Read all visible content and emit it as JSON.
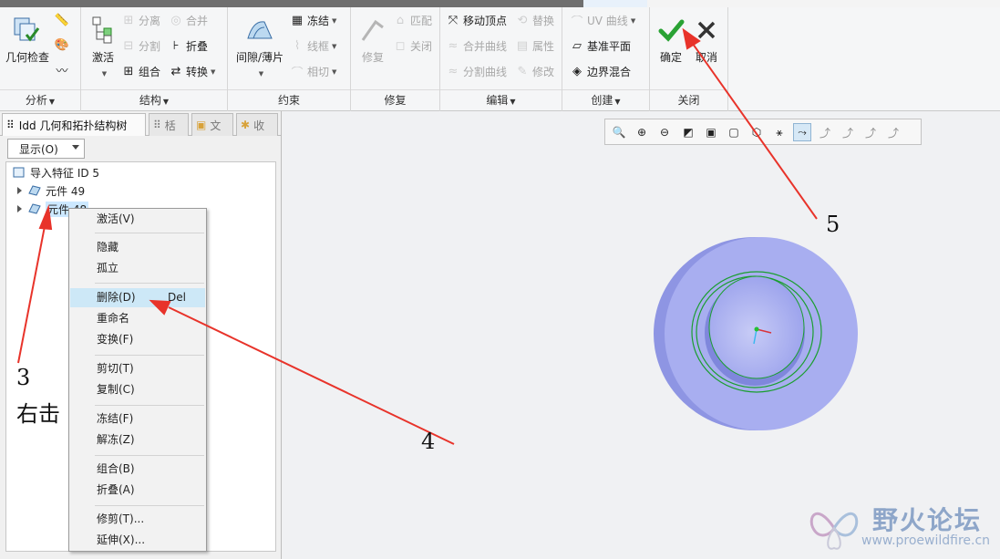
{
  "ribbon": {
    "groups": [
      {
        "key": "analysis",
        "label": "分析"
      },
      {
        "key": "structure",
        "label": "结构"
      },
      {
        "key": "constraint",
        "label": "约束"
      },
      {
        "key": "repair",
        "label": "修复"
      },
      {
        "key": "edit",
        "label": "编辑"
      },
      {
        "key": "create",
        "label": "创建"
      },
      {
        "key": "close",
        "label": "关闭"
      }
    ],
    "analysis": {
      "geom_check": "几何检查"
    },
    "structure": {
      "activate": "激活",
      "separate": "分离",
      "split": "分割",
      "group": "组合",
      "merge": "合并",
      "fold": "折叠",
      "convert": "转换"
    },
    "constraint": {
      "gap_thin": "间隙/薄片",
      "freeze": "冻结",
      "wireframe": "线框",
      "tangent": "相切"
    },
    "repair": {
      "repair": "修复",
      "match": "匹配",
      "close": "关闭"
    },
    "edit": {
      "move_vertex": "移动顶点",
      "merge_curve": "合并曲线",
      "split_curve": "分割曲线",
      "replace": "替换",
      "properties": "属性",
      "modify": "修改"
    },
    "create": {
      "uv_curve": "UV 曲线",
      "datum_plane": "基准平面",
      "boundary_blend": "边界混合"
    },
    "close": {
      "ok": "确定",
      "cancel": "取消"
    }
  },
  "left_panel": {
    "tabs": [
      {
        "label": "Idd 几何和拓扑结构树"
      },
      {
        "label": "栝"
      },
      {
        "label": "文"
      },
      {
        "label": "收"
      }
    ],
    "show_button": "显示(O)",
    "tree": [
      {
        "label": "导入特征 ID 5",
        "level": 0
      },
      {
        "label": "元件 49",
        "level": 1
      },
      {
        "label": "元件 48",
        "level": 1,
        "selected": true
      }
    ]
  },
  "context_menu": {
    "items": [
      {
        "label": "激活(V)"
      },
      {
        "label": "隐藏"
      },
      {
        "label": "孤立"
      },
      {
        "label": "删除(D)",
        "shortcut": "Del",
        "highlighted": true
      },
      {
        "label": "重命名"
      },
      {
        "label": "变换(F)"
      },
      {
        "label": "剪切(T)"
      },
      {
        "label": "复制(C)"
      },
      {
        "label": "冻结(F)"
      },
      {
        "label": "解冻(Z)"
      },
      {
        "label": "组合(B)"
      },
      {
        "label": "折叠(A)"
      },
      {
        "label": "修剪(T)..."
      },
      {
        "label": "延伸(X)..."
      }
    ]
  },
  "annotations": {
    "three": "3",
    "right_click": "右击",
    "four": "4",
    "five": "5"
  },
  "watermark": {
    "title": "野火论坛",
    "url": "www.proewildfire.cn"
  },
  "colors": {
    "ribbon_bg": "#f5f6f7",
    "model_face": "#a8aef0",
    "model_rim": "#8e95e3",
    "arrow_red": "#e8332a",
    "edge_green": "#1a9e2f",
    "ok_green": "#2aa234",
    "highlight": "#cde8f7"
  }
}
